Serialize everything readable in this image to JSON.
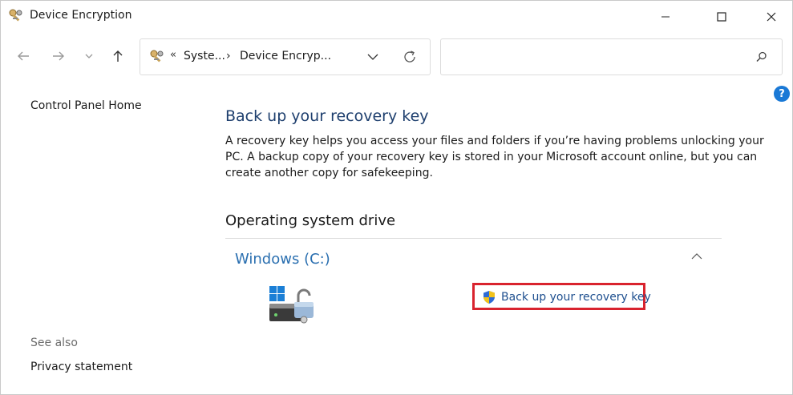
{
  "window": {
    "title": "Device Encryption",
    "icons": {
      "app": "control-panel-keys-icon",
      "minimize": "minimize-icon",
      "maximize": "maximize-icon",
      "close": "close-icon"
    }
  },
  "nav": {
    "back": "arrow-left-icon",
    "forward": "arrow-right-icon",
    "recent": "chevron-down-icon",
    "up": "arrow-up-icon"
  },
  "address": {
    "overflow": "«",
    "segments": [
      "Syste...",
      "Device Encryp..."
    ],
    "separator": "›"
  },
  "search": {
    "placeholder": "",
    "icon": "search-icon"
  },
  "help": {
    "label": "?"
  },
  "sidebar": {
    "control_panel_home": "Control Panel Home",
    "see_also": "See also",
    "privacy_statement": "Privacy statement"
  },
  "main": {
    "heading": "Back up your recovery key",
    "description": "A recovery key helps you access your files and folders if you’re having problems unlocking your PC. A backup copy of your recovery key is stored in your Microsoft account online, but you can create another copy for safekeeping.",
    "section_title": "Operating system drive",
    "drive_name": "Windows (C:)",
    "backup_link": "Back up your recovery key"
  },
  "colors": {
    "heading": "#1e3f6e",
    "drive_name": "#2a6fb0",
    "highlight_border": "#d9232e",
    "help": "#1a79d6"
  }
}
